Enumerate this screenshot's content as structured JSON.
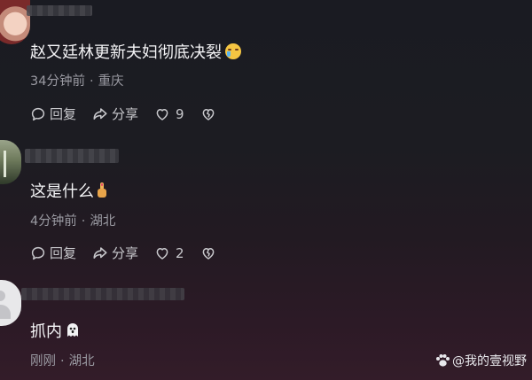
{
  "comments": [
    {
      "text": "赵又廷林更新夫妇彻底决裂",
      "emoji": "crying-laugh-emoji",
      "time": "34分钟前",
      "location": "重庆",
      "reply_label": "回复",
      "share_label": "分享",
      "like_count": "9"
    },
    {
      "text": "这是什么",
      "emoji": "pointing-hand-emoji",
      "time": "4分钟前",
      "location": "湖北",
      "reply_label": "回复",
      "share_label": "分享",
      "like_count": "2"
    },
    {
      "text": "抓内",
      "emoji": "ghost-emoji",
      "time": "刚刚",
      "location": "湖北"
    }
  ],
  "separator": "·",
  "watermark": "@我的壹视野",
  "colors": {
    "background_top": "#1a1b22",
    "background_bottom": "#331c29",
    "text_primary": "#f4f4f6",
    "text_meta": "#9a9aa2"
  }
}
